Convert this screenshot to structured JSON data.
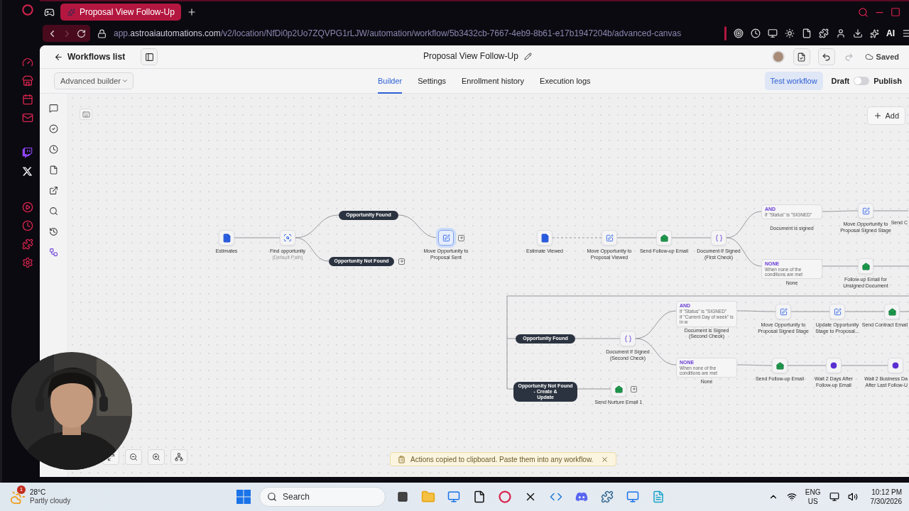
{
  "browser": {
    "tab_title": "Proposal View Follow-Up",
    "url": {
      "subdomain": "app.",
      "domain": "astroaiautomations.com",
      "path": "/v2/location/NfDi0p2Uo7ZQVPG1rLJW/automation/workflow/5b3432cb-7667-4eb9-8b61-e17b1947204b/advanced-canvas"
    },
    "ai_label": "AI"
  },
  "header": {
    "back_label": "Workflows list",
    "title": "Proposal View Follow-Up",
    "undo_disabled": false,
    "redo_disabled": true,
    "status": "Saved"
  },
  "builder_select": "Advanced builder",
  "tabs": [
    {
      "label": "Builder",
      "selected": true
    },
    {
      "label": "Settings",
      "selected": false
    },
    {
      "label": "Enrollment history",
      "selected": false
    },
    {
      "label": "Execution logs",
      "selected": false
    }
  ],
  "test_button": "Test workflow",
  "draft_label": "Draft",
  "publish": {
    "label": "Publish",
    "on": false
  },
  "add_button": "Add",
  "nodes": [
    {
      "kind": "document",
      "lines": [
        "Estimates"
      ],
      "selected": false,
      "add_after": false
    },
    {
      "kind": "search",
      "lines": [
        "Find opportunity"
      ],
      "note": "(Default Path)",
      "selected": false,
      "add_after": false
    },
    {
      "kind": "pill",
      "lines": [
        "Opportunity Found"
      ],
      "selected": false,
      "add_after": false
    },
    {
      "kind": "pill",
      "lines": [
        "Opportunity Not Found"
      ],
      "selected": false,
      "add_after": true
    },
    {
      "kind": "move",
      "lines": [
        "Move Opportunity to",
        "Proposal Sent"
      ],
      "selected": true,
      "add_after": true
    },
    {
      "kind": "document",
      "lines": [
        "Estimate Viewed"
      ],
      "selected": false,
      "add_after": false
    },
    {
      "kind": "move",
      "lines": [
        "Move Opportunity to",
        "Proposal Viewed"
      ],
      "selected": false,
      "add_after": false
    },
    {
      "kind": "email",
      "lines": [
        "Send Follow-up Email"
      ],
      "selected": false,
      "add_after": false
    },
    {
      "kind": "ifelse",
      "lines": [
        "Document If Signed",
        "(First Check)"
      ],
      "selected": false,
      "add_after": false
    },
    {
      "kind": "condition",
      "tag": "AND",
      "rules": [
        "If \"Status\" is \"SIGNED\""
      ],
      "lines": [
        "Document is signed"
      ],
      "selected": false,
      "add_after": false
    },
    {
      "kind": "move",
      "lines": [
        "Move Opportunity to",
        "Proposal Signed Stage"
      ],
      "selected": false,
      "add_after": false
    },
    {
      "kind": "offscreen",
      "lines": [
        "Send C"
      ],
      "selected": false,
      "add_after": false
    },
    {
      "kind": "condition",
      "tag": "NONE",
      "rules": [
        "When none of the conditions are met"
      ],
      "lines": [
        "None"
      ],
      "selected": false,
      "add_after": false
    },
    {
      "kind": "email",
      "lines": [
        "Follow-up Email for",
        "Unsigned Document"
      ],
      "selected": false,
      "add_after": false
    },
    {
      "kind": "pill",
      "lines": [
        "Opportunity Found"
      ],
      "selected": false,
      "add_after": false
    },
    {
      "kind": "ifelse",
      "lines": [
        "Document If Signed",
        "(Second Check)"
      ],
      "selected": false,
      "add_after": false
    },
    {
      "kind": "condition",
      "tag": "AND",
      "rules": [
        "If \"Status\" is \"SIGNED\"",
        "If \"Current Day of week\" is in w"
      ],
      "lines": [
        "Document is Signed",
        "(Second Check)"
      ],
      "selected": false,
      "add_after": false
    },
    {
      "kind": "move",
      "lines": [
        "Move Opportunity to",
        "Proposal Signed Stage"
      ],
      "selected": false,
      "add_after": false
    },
    {
      "kind": "move",
      "lines": [
        "Update Opportunity",
        "Stage to Proposal..."
      ],
      "selected": false,
      "add_after": false
    },
    {
      "kind": "email",
      "lines": [
        "Send Contract Email"
      ],
      "selected": false,
      "add_after": false
    },
    {
      "kind": "condition",
      "tag": "NONE",
      "rules": [
        "When none of the conditions are met"
      ],
      "lines": [
        "None"
      ],
      "selected": false,
      "add_after": false
    },
    {
      "kind": "email",
      "lines": [
        "Send Follow-up Email"
      ],
      "selected": false,
      "add_after": false
    },
    {
      "kind": "wait",
      "lines": [
        "Wait 2 Days After",
        "Follow-up Email"
      ],
      "selected": false,
      "add_after": false
    },
    {
      "kind": "wait",
      "lines": [
        "Wait 2 Business Da",
        "After Last Follow-U"
      ],
      "selected": false,
      "add_after": false
    },
    {
      "kind": "pill",
      "lines": [
        "Opportunity Not Found - Create &",
        "Update"
      ],
      "selected": false,
      "add_after": false
    },
    {
      "kind": "email",
      "lines": [
        "Send Nurture Email 1"
      ],
      "selected": false,
      "add_after": true
    }
  ],
  "toast": "Actions copied to clipboard. Paste them into any workflow.",
  "taskbar": {
    "weather_badge": "1",
    "temperature": "28°C",
    "weather": "Partly cloudy",
    "search": "Search",
    "language": "ENG",
    "region": "US",
    "time": "10:12 PM",
    "date": "7/30/2026"
  }
}
